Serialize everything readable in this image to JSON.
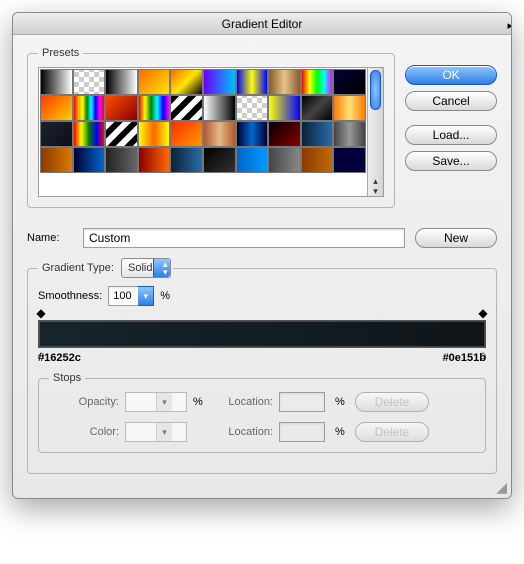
{
  "window": {
    "title": "Gradient Editor"
  },
  "buttons": {
    "ok": "OK",
    "cancel": "Cancel",
    "load": "Load...",
    "save": "Save...",
    "new": "New",
    "delete": "Delete"
  },
  "presets": {
    "legend": "Presets",
    "swatches": [
      "linear-gradient(90deg,#000,#fff)",
      "repeating-conic-gradient(#ccc 0 25%, #fff 0 50%) 0/10px 10px",
      "linear-gradient(90deg,#000,#fff)",
      "linear-gradient(135deg,#ff6a00,#ffe600)",
      "linear-gradient(135deg,#ff6a00,#ffe600,#000)",
      "linear-gradient(90deg,#6a00ff,#00c2ff)",
      "linear-gradient(90deg,#00f,#ff0,#00f)",
      "linear-gradient(90deg,#8a5a2b,#e6c487,#8a5a2b)",
      "linear-gradient(90deg,#ff0000,#ffff00,#00ff00,#00ffff,#ff00ff)",
      "linear-gradient(135deg,#003,#000)",
      "linear-gradient(135deg,#ff3b00,#ffd000)",
      "linear-gradient(90deg,red,orange,yellow,green,cyan,blue,magenta,red)",
      "linear-gradient(135deg,#ff4d00,#8a0000)",
      "linear-gradient(90deg,red,yellow,green,cyan,blue,magenta)",
      "repeating-linear-gradient(135deg,#000 0 6px,#fff 6px 12px)",
      "linear-gradient(90deg,#fff,#000)",
      "repeating-conic-gradient(#ccc 0 25%, #fff 0 50%) 0/10px 10px",
      "linear-gradient(90deg,#ff0,#00f)",
      "linear-gradient(135deg,#000,#444,#000)",
      "linear-gradient(90deg,#ff7a00,#ffe27a,#ff7a00)",
      "linear-gradient(135deg,#1b2330,#0b0f14)",
      "linear-gradient(90deg,red,yellow,green,blue,red)",
      "repeating-linear-gradient(135deg,#fff 0 6px,#000 6px 12px)",
      "linear-gradient(90deg,#ff0,#f60,#ff0)",
      "linear-gradient(135deg,#ff2e00,#ff9a00)",
      "linear-gradient(90deg,#b05a2b,#e6b887,#b05a2b)",
      "linear-gradient(90deg,#003,#06c,#003)",
      "linear-gradient(135deg,#000,#8a0000)",
      "linear-gradient(90deg,#0a2238,#2b6ba8)",
      "linear-gradient(90deg,#444,#999,#444)",
      "linear-gradient(90deg,#8a3a00,#d97a00)",
      "linear-gradient(90deg,#003,#06c)",
      "linear-gradient(90deg,#222,#666)",
      "linear-gradient(90deg,#8a0000,#ff6a00)",
      "linear-gradient(90deg,#0a2238,#2b6ba8)",
      "linear-gradient(135deg,#000,#333)",
      "linear-gradient(90deg,#06c,#09f)",
      "linear-gradient(90deg,#444,#888)",
      "linear-gradient(90deg,#8a3a00,#c46a00)",
      "linear-gradient(90deg,#003,#004)"
    ]
  },
  "name": {
    "label": "Name:",
    "value": "Custom"
  },
  "gradientType": {
    "legend": "Gradient Type:",
    "value": "Solid",
    "smoothness_label": "Smoothness:",
    "smoothness_value": "100",
    "smoothness_unit": "%"
  },
  "gradient": {
    "left_color": "#16252c",
    "right_color": "#0e151b"
  },
  "stops": {
    "legend": "Stops",
    "opacity_label": "Opacity:",
    "color_label": "Color:",
    "location_label": "Location:",
    "unit": "%",
    "opacity_value": "",
    "opacity_location": "",
    "color_value": "",
    "color_location": ""
  }
}
